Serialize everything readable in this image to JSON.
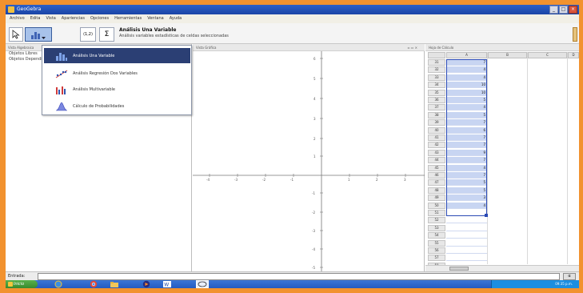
{
  "window": {
    "title": "GeoGebra"
  },
  "menu": [
    "Archivo",
    "Edita",
    "Vista",
    "Apariencias",
    "Opciones",
    "Herramientas",
    "Ventana",
    "Ayuda"
  ],
  "toolbar": {
    "tool_title": "Análisis Una Variable",
    "tool_description": "Análisis variables estadísticas de celdas seleccionadas",
    "formula_button": "(1,2)",
    "sum_button": "Σ"
  },
  "algebra": {
    "header": "Vista Algebraica",
    "items": [
      "Objetos Libres",
      "Objetos Dependientes"
    ]
  },
  "dropdown": {
    "items": [
      {
        "label": "Análisis Una Variable",
        "icon": "histogram-icon"
      },
      {
        "label": "Análisis Regresión Dos Variables",
        "icon": "scatter-icon"
      },
      {
        "label": "Análisis Multivariable",
        "icon": "multi-bar-icon"
      },
      {
        "label": "Cálculo de Probabilidades",
        "icon": "bell-curve-icon"
      }
    ]
  },
  "graphics": {
    "header": "Vista Gráfica",
    "x_ticks": [
      "-4",
      "-3",
      "-2",
      "-1",
      "1",
      "2",
      "3",
      "4"
    ],
    "y_ticks": [
      "6",
      "5",
      "4",
      "3",
      "2",
      "1",
      "-1",
      "-2",
      "-3",
      "-4",
      "-5",
      "-6"
    ]
  },
  "spreadsheet": {
    "header": "Hoja de Cálculo",
    "columns": [
      "A",
      "B",
      "C",
      "D"
    ],
    "rows": [
      {
        "label": "31",
        "value": "7"
      },
      {
        "label": "32",
        "value": "4"
      },
      {
        "label": "33",
        "value": "4"
      },
      {
        "label": "34",
        "value": "10"
      },
      {
        "label": "35",
        "value": "10"
      },
      {
        "label": "36",
        "value": "5"
      },
      {
        "label": "37",
        "value": "4"
      },
      {
        "label": "38",
        "value": "5"
      },
      {
        "label": "39",
        "value": "7"
      },
      {
        "label": "40",
        "value": "6"
      },
      {
        "label": "41",
        "value": "7"
      },
      {
        "label": "42",
        "value": "7"
      },
      {
        "label": "43",
        "value": "9"
      },
      {
        "label": "44",
        "value": "7"
      },
      {
        "label": "45",
        "value": "4"
      },
      {
        "label": "46",
        "value": "7"
      },
      {
        "label": "47",
        "value": "5"
      },
      {
        "label": "48",
        "value": "5"
      },
      {
        "label": "49",
        "value": "3"
      },
      {
        "label": "50",
        "value": "4"
      },
      {
        "label": "51",
        "value": ""
      },
      {
        "label": "52",
        "value": ""
      },
      {
        "label": "53",
        "value": ""
      },
      {
        "label": "54",
        "value": ""
      },
      {
        "label": "55",
        "value": ""
      },
      {
        "label": "56",
        "value": ""
      },
      {
        "label": "57",
        "value": ""
      },
      {
        "label": "58",
        "value": ""
      }
    ]
  },
  "input_bar": {
    "label": "Entrada:",
    "value": "",
    "alpha_button": "α"
  },
  "taskbar": {
    "start_label": "Inicio",
    "clock": "09:35 p.m."
  },
  "colors": {
    "page_border": "#f2922f",
    "title_bar": "#2d5fc8",
    "dropdown_active": "#2b3f74",
    "cell_selection": "#c8d5f2",
    "selection_border": "#2a49b4",
    "taskbar": "#245bc0"
  }
}
